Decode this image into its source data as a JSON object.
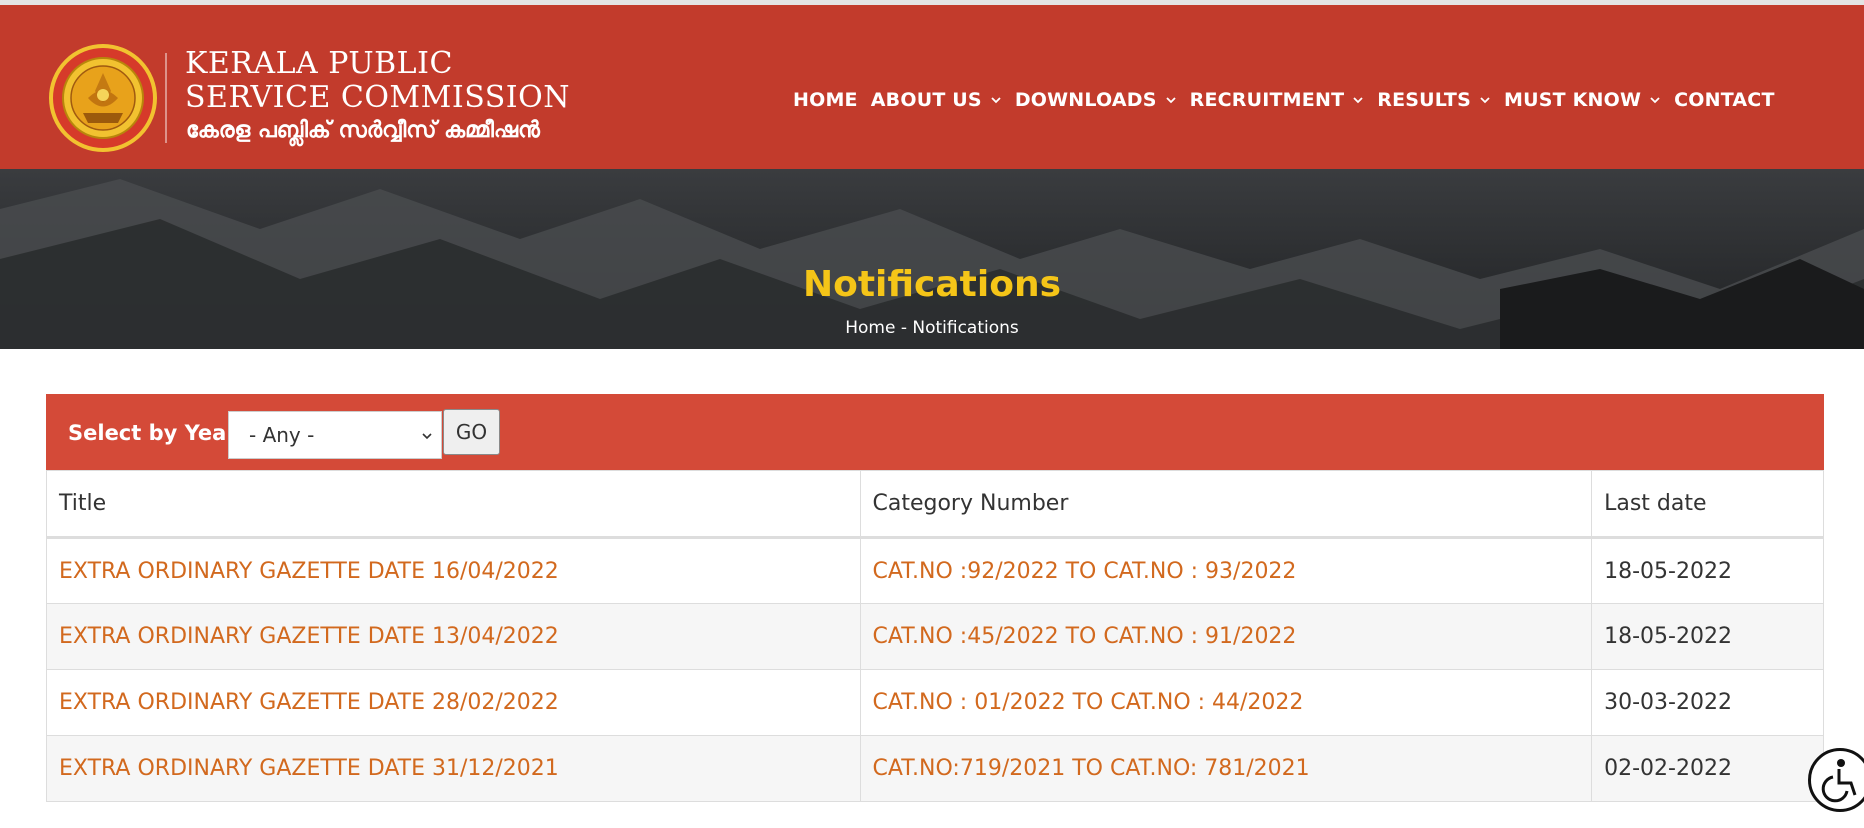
{
  "brand": {
    "line1": "KERALA PUBLIC",
    "line2": "SERVICE COMMISSION",
    "malayalam": "കേരള പബ്ലിക് സർവ്വീസ് കമ്മീഷൻ",
    "seal_text": "PUBLIC SERVICE COMMISSION KERALA"
  },
  "nav": [
    {
      "label": "HOME",
      "has_dropdown": false
    },
    {
      "label": "ABOUT US",
      "has_dropdown": true
    },
    {
      "label": "DOWNLOADS",
      "has_dropdown": true
    },
    {
      "label": "RECRUITMENT",
      "has_dropdown": true
    },
    {
      "label": "RESULTS",
      "has_dropdown": true
    },
    {
      "label": "MUST KNOW",
      "has_dropdown": true
    },
    {
      "label": "CONTACT",
      "has_dropdown": false
    }
  ],
  "banner": {
    "title": "Notifications",
    "breadcrumb": {
      "home": "Home",
      "separator": " - ",
      "current": "Notifications"
    }
  },
  "filter": {
    "label": "Select by Year",
    "selected": "- Any -",
    "go_label": "GO"
  },
  "table": {
    "headers": [
      "Title",
      "Category Number",
      "Last date"
    ],
    "rows": [
      {
        "title": "EXTRA ORDINARY GAZETTE DATE 16/04/2022",
        "category": "CAT.NO :92/2022 TO CAT.NO : 93/2022",
        "last_date": "18-05-2022"
      },
      {
        "title": "EXTRA ORDINARY GAZETTE DATE 13/04/2022",
        "category": "CAT.NO :45/2022 TO CAT.NO : 91/2022",
        "last_date": "18-05-2022"
      },
      {
        "title": "EXTRA ORDINARY GAZETTE DATE 28/02/2022",
        "category": "CAT.NO : 01/2022 TO CAT.NO : 44/2022",
        "last_date": "30-03-2022"
      },
      {
        "title": "EXTRA ORDINARY GAZETTE DATE 31/12/2021",
        "category": "CAT.NO:719/2021 TO CAT.NO: 781/2021",
        "last_date": "02-02-2022"
      }
    ]
  },
  "colors": {
    "header_bg": "#c23b2c",
    "filter_bg": "#d44a38",
    "banner_title": "#f5c518",
    "link": "#d2691e"
  },
  "icons": {
    "logo": "kerala-psc-seal",
    "accessibility": "accessibility-wheelchair-icon"
  }
}
